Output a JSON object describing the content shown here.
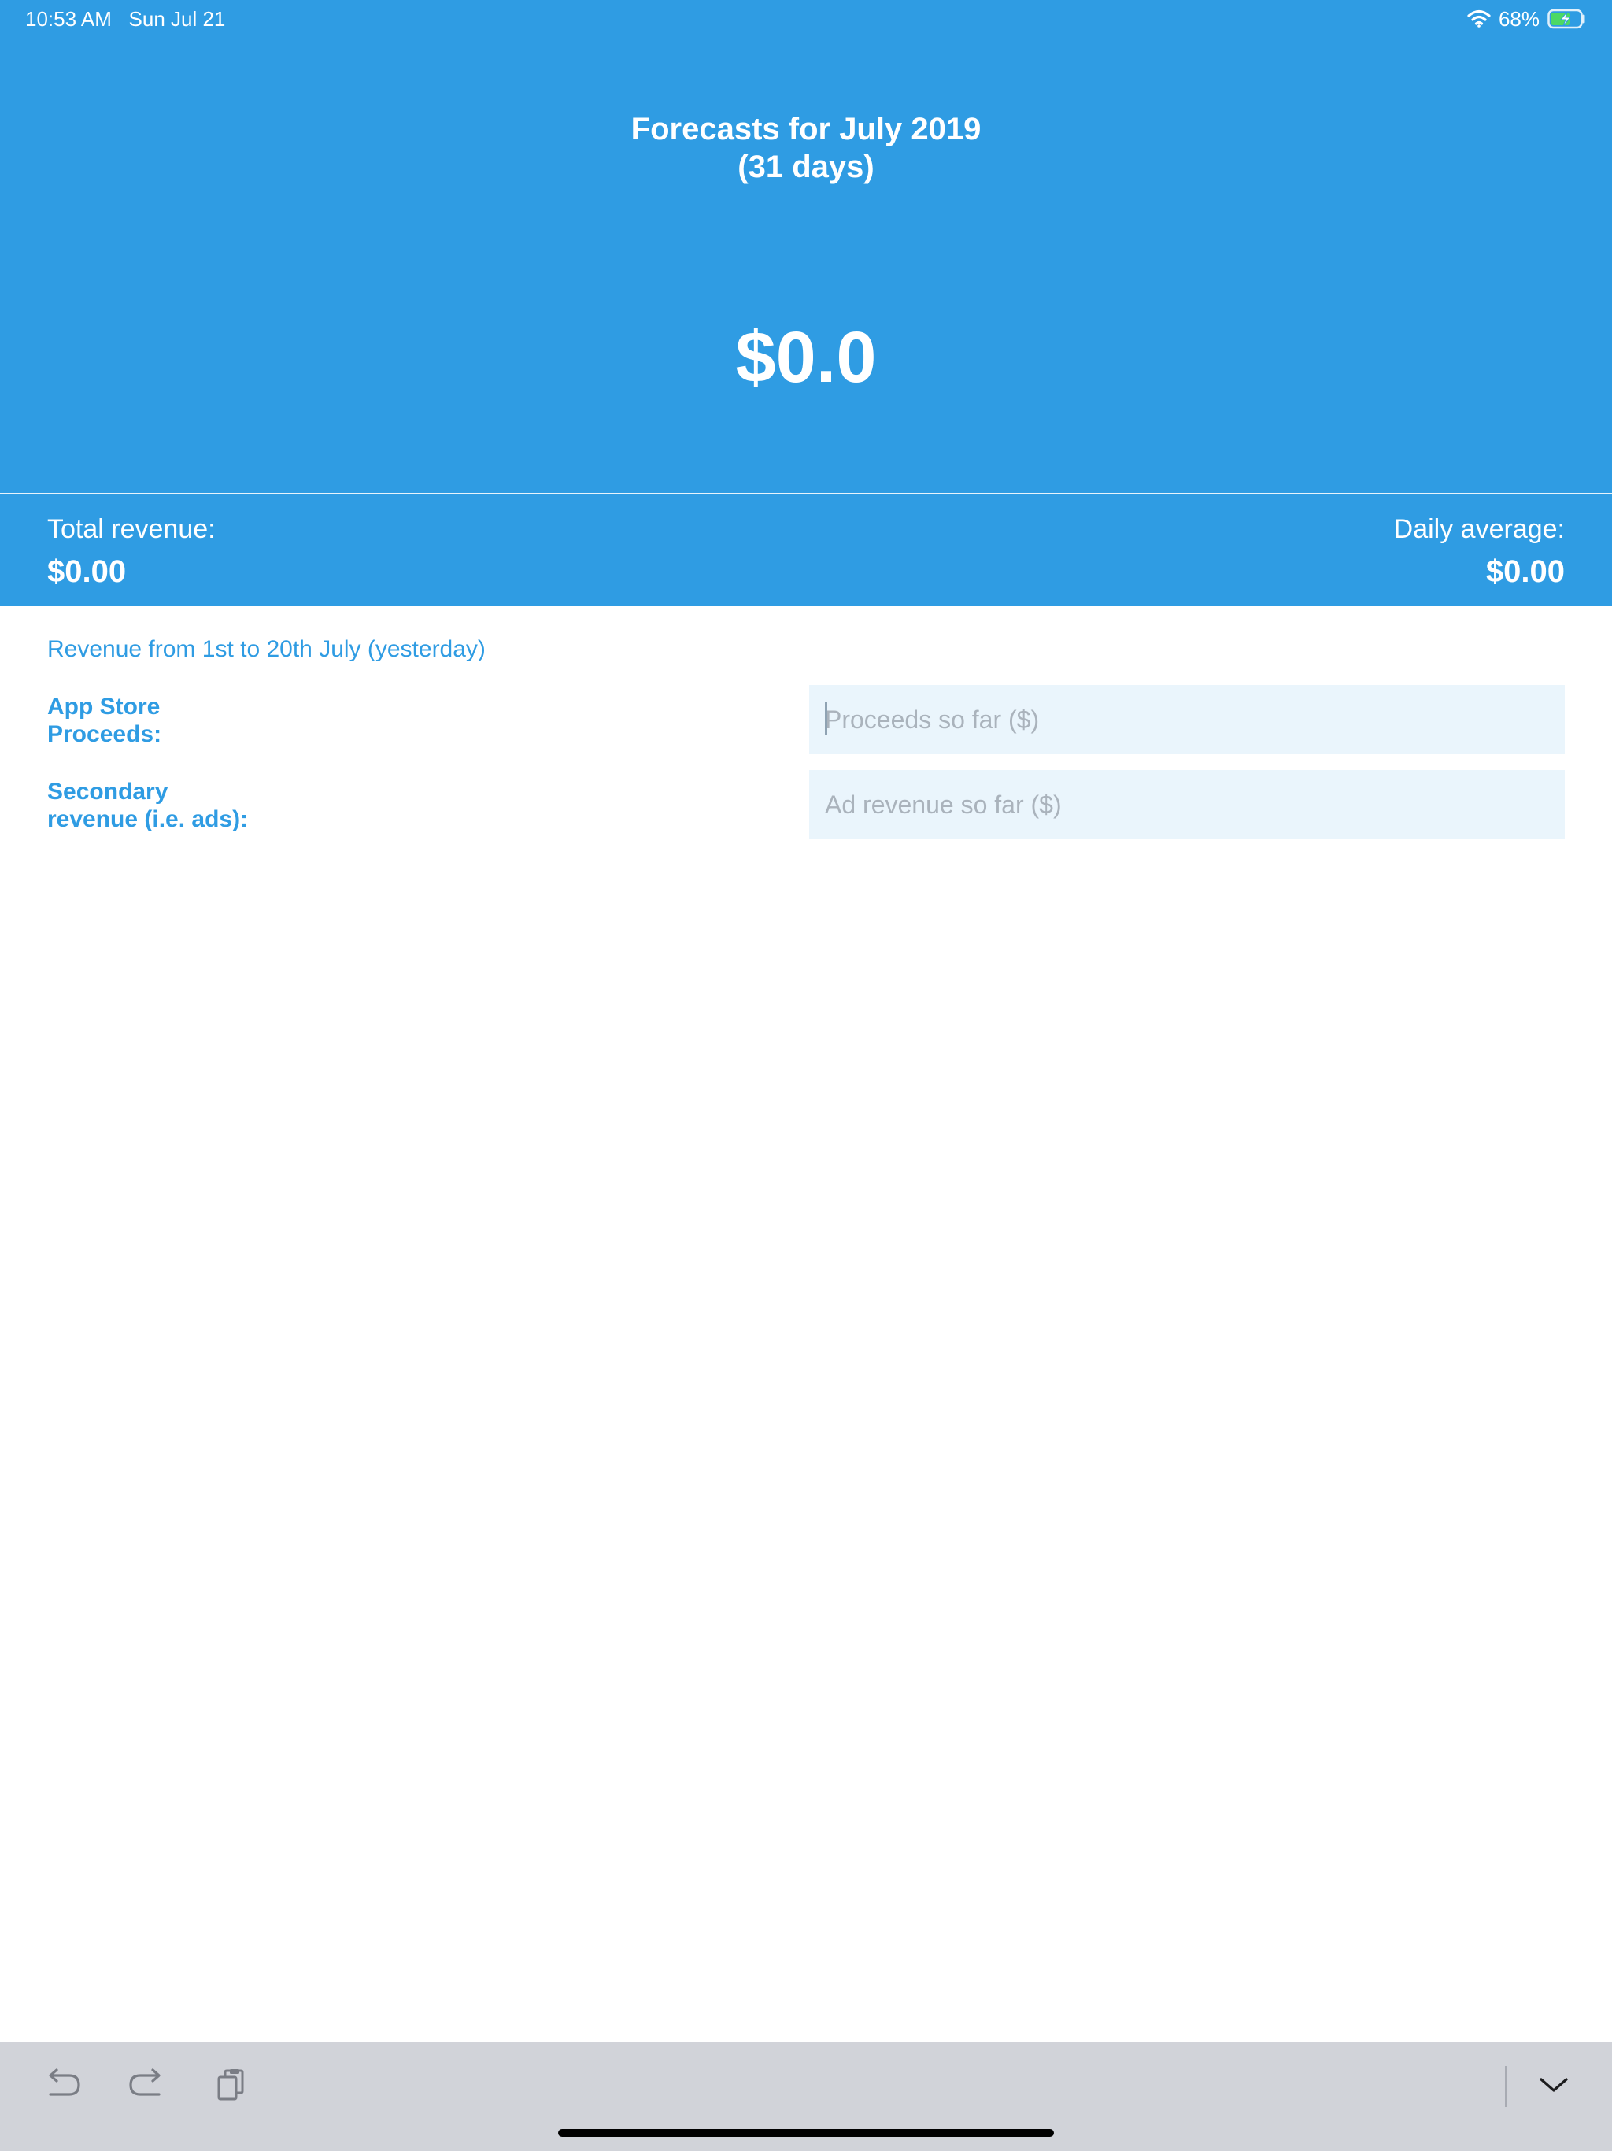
{
  "status_bar": {
    "time": "10:53 AM",
    "date": "Sun Jul 21",
    "battery_percent": "68%",
    "battery_level": 0.68,
    "icons": [
      "wifi-icon",
      "battery-charging-icon"
    ]
  },
  "header": {
    "title_line1": "Forecasts for July 2019",
    "title_line2": "(31 days)",
    "forecast_value": "$0.0"
  },
  "summary": {
    "total_label": "Total revenue:",
    "total_value": "$0.00",
    "average_label": "Daily average:",
    "average_value": "$0.00"
  },
  "form": {
    "caption": "Revenue from 1st to 20th July (yesterday)",
    "proceeds_label": "App Store\nProceeds:",
    "proceeds_placeholder": "Proceeds so far ($)",
    "proceeds_value": "",
    "secondary_label": "Secondary\nrevenue (i.e. ads):",
    "secondary_placeholder": "Ad revenue so far ($)",
    "secondary_value": ""
  },
  "keyboard_bar": {
    "icons": [
      "undo-icon",
      "redo-icon",
      "paste-icon",
      "dismiss-keyboard-icon"
    ]
  },
  "colors": {
    "accent": "#2f9ce3",
    "input_background": "#eaf5fc",
    "keyboard_bar": "#d1d3d9"
  }
}
